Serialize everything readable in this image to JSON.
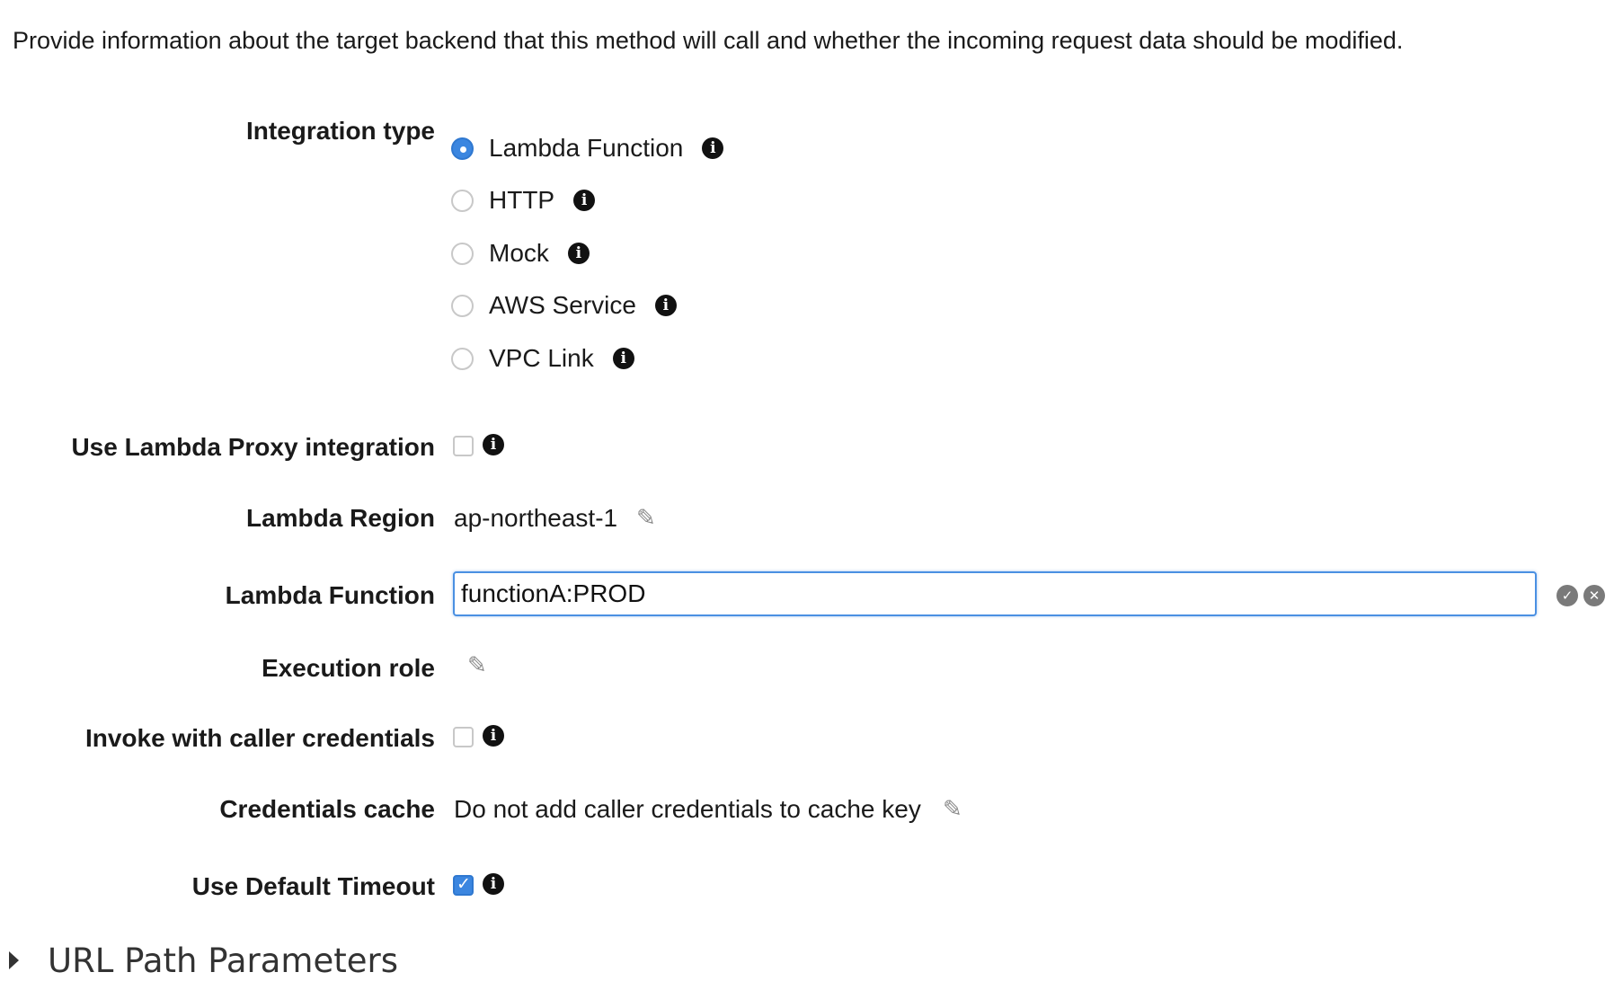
{
  "intro": "Provide information about the target backend that this method will call and whether the incoming request data should be modified.",
  "integration_type": {
    "label": "Integration type",
    "options": [
      {
        "label": "Lambda Function",
        "selected": true
      },
      {
        "label": "HTTP",
        "selected": false
      },
      {
        "label": "Mock",
        "selected": false
      },
      {
        "label": "AWS Service",
        "selected": false
      },
      {
        "label": "VPC Link",
        "selected": false
      }
    ]
  },
  "lambda_proxy": {
    "label": "Use Lambda Proxy integration",
    "checked": false
  },
  "lambda_region": {
    "label": "Lambda Region",
    "value": "ap-northeast-1"
  },
  "lambda_function": {
    "label": "Lambda Function",
    "value": "functionA:PROD"
  },
  "execution_role": {
    "label": "Execution role",
    "value": ""
  },
  "invoke_caller_credentials": {
    "label": "Invoke with caller credentials",
    "checked": false
  },
  "credentials_cache": {
    "label": "Credentials cache",
    "value": "Do not add caller credentials to cache key"
  },
  "default_timeout": {
    "label": "Use Default Timeout",
    "checked": true
  },
  "url_path_parameters": {
    "title": "URL Path Parameters",
    "expanded": false
  },
  "icons": {
    "info": "info-icon",
    "edit": "pencil-icon",
    "confirm": "check-circle-icon",
    "cancel": "x-circle-icon",
    "expand": "caret-right-icon"
  },
  "colors": {
    "accent": "#3b86e0",
    "input_border": "#4a90e2",
    "text": "#1a1a1a"
  }
}
